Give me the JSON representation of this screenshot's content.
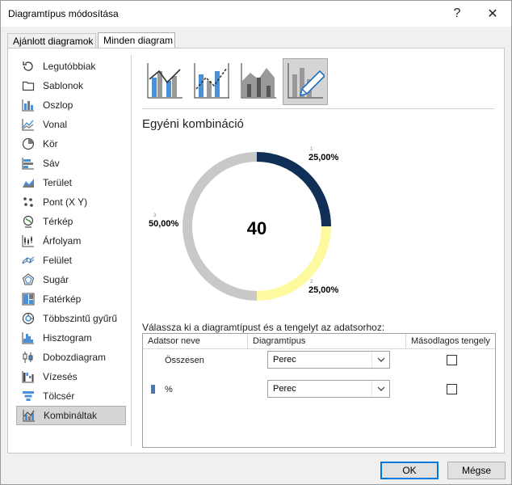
{
  "window": {
    "title": "Diagramtípus módosítása",
    "help_label": "?",
    "close_label": "✕"
  },
  "tabs": [
    {
      "label": "Ajánlott diagramok",
      "active": false
    },
    {
      "label": "Minden diagram",
      "active": true
    }
  ],
  "sidebar": {
    "items": [
      {
        "label": "Legutóbbiak",
        "icon": "recent-icon"
      },
      {
        "label": "Sablonok",
        "icon": "folder-icon"
      },
      {
        "label": "Oszlop",
        "icon": "column-chart-icon"
      },
      {
        "label": "Vonal",
        "icon": "line-chart-icon"
      },
      {
        "label": "Kör",
        "icon": "pie-chart-icon"
      },
      {
        "label": "Sáv",
        "icon": "bar-chart-icon"
      },
      {
        "label": "Terület",
        "icon": "area-chart-icon"
      },
      {
        "label": "Pont (X Y)",
        "icon": "scatter-chart-icon"
      },
      {
        "label": "Térkép",
        "icon": "map-chart-icon"
      },
      {
        "label": "Árfolyam",
        "icon": "stock-chart-icon"
      },
      {
        "label": "Felület",
        "icon": "surface-chart-icon"
      },
      {
        "label": "Sugár",
        "icon": "radar-chart-icon"
      },
      {
        "label": "Fatérkép",
        "icon": "treemap-chart-icon"
      },
      {
        "label": "Többszintű gyűrű",
        "icon": "sunburst-chart-icon"
      },
      {
        "label": "Hisztogram",
        "icon": "histogram-chart-icon"
      },
      {
        "label": "Dobozdiagram",
        "icon": "box-whisker-chart-icon"
      },
      {
        "label": "Vízesés",
        "icon": "waterfall-chart-icon"
      },
      {
        "label": "Tölcsér",
        "icon": "funnel-chart-icon"
      },
      {
        "label": "Kombináltak",
        "icon": "combo-chart-icon",
        "selected": true
      }
    ]
  },
  "combo_variants": [
    {
      "icon": "combo-clustered-column-line-icon"
    },
    {
      "icon": "combo-column-line-secondary-axis-icon"
    },
    {
      "icon": "combo-stacked-area-column-icon"
    },
    {
      "icon": "custom-combination-icon",
      "selected": true
    }
  ],
  "preview": {
    "heading": "Egyéni kombináció",
    "center_label": "40"
  },
  "chart_data": {
    "type": "pie",
    "chart_style": "doughnut",
    "center_value": "40",
    "categories": [
      "1",
      "2",
      "3"
    ],
    "values": [
      25,
      25,
      50
    ],
    "data_labels": [
      "25,00%",
      "25,00%",
      "50,00%"
    ],
    "colors": [
      "#0f2f57",
      "#fdf99e",
      "#c8c8c8"
    ],
    "start_angle_deg": 0,
    "legend": "none"
  },
  "series_config": {
    "instruction": "Válassza ki a diagramtípust és a tengelyt az adatsorhoz:",
    "headers": [
      "Adatsor neve",
      "Diagramtípus",
      "Másodlagos tengely"
    ],
    "rows": [
      {
        "name": "Összesen",
        "chart_type": "Perec",
        "secondary_axis": false,
        "swatch": ""
      },
      {
        "name": "%",
        "chart_type": "Perec",
        "secondary_axis": false,
        "swatch": "#4a7ab5"
      }
    ]
  },
  "footer": {
    "ok_label": "OK",
    "cancel_label": "Mégse"
  }
}
